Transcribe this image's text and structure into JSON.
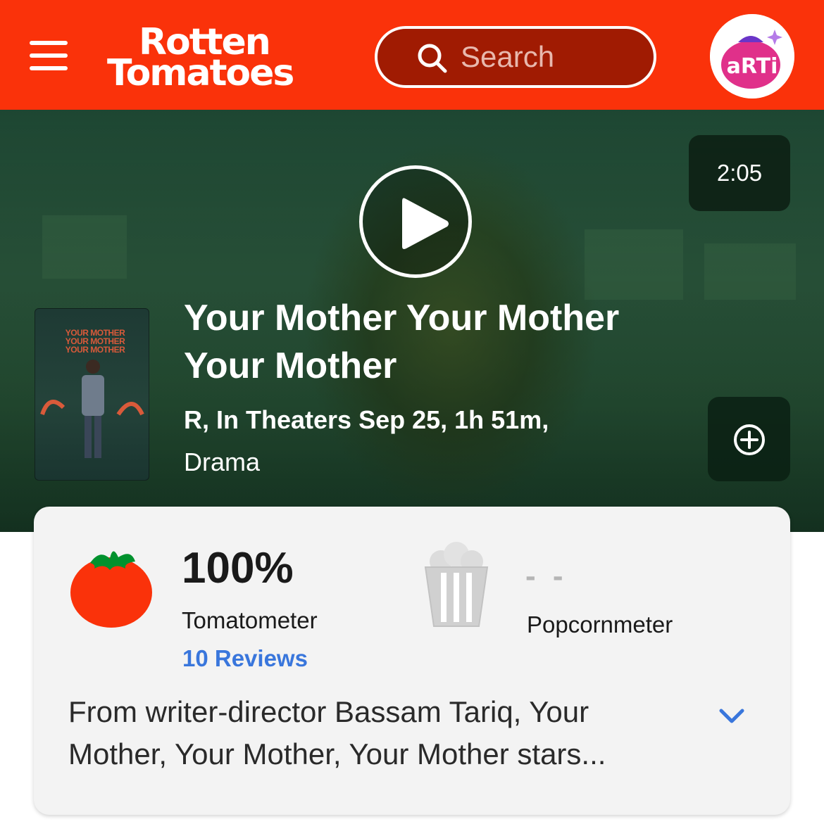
{
  "header": {
    "logo_line1": "Rotten",
    "logo_line2": "Tomatoes",
    "search_placeholder": "Search",
    "avatar_text": "aRTi",
    "brand_color": "#fa320a"
  },
  "hero": {
    "duration": "2:05",
    "title": "Your Mother Your Mother Your Mother",
    "meta": "R, In Theaters Sep 25, 1h 51m,",
    "genre": "Drama"
  },
  "scores": {
    "tomatometer_score": "100%",
    "tomatometer_label": "Tomatometer",
    "reviews_link": "10 Reviews",
    "popcornmeter_score": "- -",
    "popcornmeter_label": "Popcornmeter"
  },
  "synopsis": "From writer-director Bassam Tariq, Your Mother, Your Mother, Your Mother stars...",
  "icons": {
    "menu": "menu-icon",
    "search": "search-icon",
    "play": "play-icon",
    "add": "plus-circle-icon",
    "tomato": "tomato-icon",
    "popcorn": "popcorn-bucket-icon",
    "expand": "chevron-down-icon"
  },
  "colors": {
    "link": "#3976dc",
    "tomato_red": "#fa320a"
  }
}
